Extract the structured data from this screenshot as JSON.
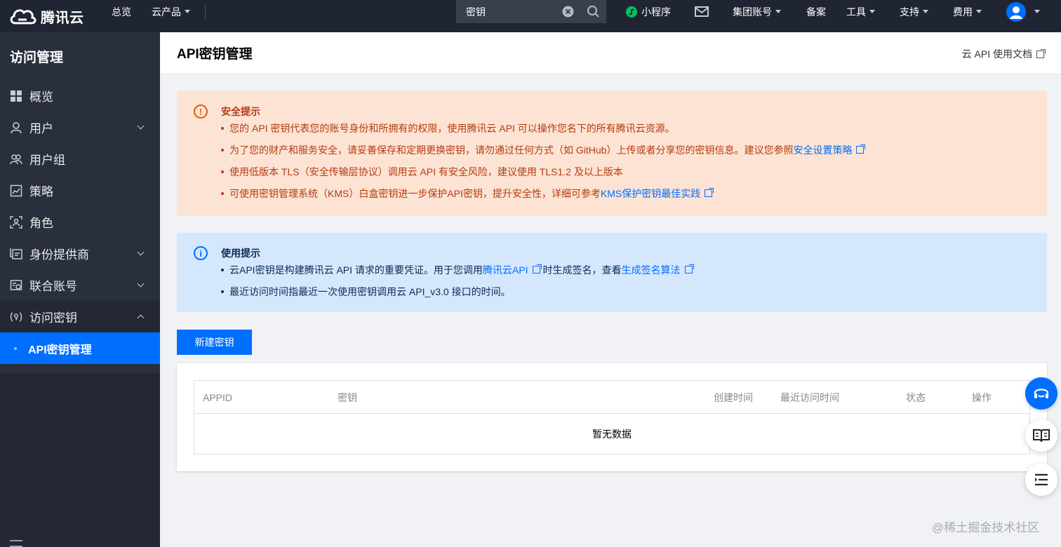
{
  "topbar": {
    "brand": "腾讯云",
    "nav": [
      "总览",
      "云产品"
    ],
    "search_value": "密钥",
    "mini_program": "小程序",
    "group_account": "集团账号",
    "filing": "备案",
    "tools": "工具",
    "support": "支持",
    "billing": "费用"
  },
  "sidebar": {
    "title": "访问管理",
    "items": [
      {
        "label": "概览",
        "icon": "grid-icon"
      },
      {
        "label": "用户",
        "icon": "user-icon"
      },
      {
        "label": "用户组",
        "icon": "users-icon"
      },
      {
        "label": "策略",
        "icon": "policy-icon"
      },
      {
        "label": "角色",
        "icon": "role-icon"
      },
      {
        "label": "身份提供商",
        "icon": "identity-provider-icon"
      },
      {
        "label": "联合账号",
        "icon": "federated-account-icon"
      },
      {
        "label": "访问密钥",
        "icon": "key-icon"
      }
    ],
    "sub_item": "API密钥管理"
  },
  "header": {
    "title": "API密钥管理",
    "doc_link": "云 API 使用文档"
  },
  "security_alert": {
    "title": "安全提示",
    "items": [
      {
        "text": "您的 API 密钥代表您的账号身份和所拥有的权限，使用腾讯云 API 可以操作您名下的所有腾讯云资源。"
      },
      {
        "text": "为了您的财产和服务安全，请妥善保存和定期更换密钥，请勿通过任何方式（如 GitHub）上传或者分享您的密钥信息。建议您参照",
        "link": "安全设置策略"
      },
      {
        "text": "使用低版本 TLS（安全传输层协议）调用云 API 有安全风险，建议使用 TLS1.2 及以上版本"
      },
      {
        "text": "可使用密钥管理系统（KMS）白盒密钥进一步保护API密钥，提升安全性，详细可参考",
        "link": "KMS保护密钥最佳实践"
      }
    ]
  },
  "usage_alert": {
    "title": "使用提示",
    "line1_a": "云API密钥是构建腾讯云 API 请求的重要凭证。用于您调用",
    "line1_link1": "腾讯云API",
    "line1_b": "时生成签名，查看",
    "line1_link2": "生成签名算法",
    "line2": "最近访问时间指最近一次使用密钥调用云 API_v3.0 接口的时间。"
  },
  "create_button": "新建密钥",
  "table": {
    "columns": [
      "APPID",
      "密钥",
      "创建时间",
      "最近访问时间",
      "状态",
      "操作"
    ],
    "empty_text": "暂无数据"
  },
  "watermark": "@稀土掘金技术社区",
  "colors": {
    "topbar_bg": "#1f2533",
    "sidebar_bg": "#292f3c",
    "accent": "#006eff",
    "warn_bg": "#fde3d3",
    "warn_text": "#b43c12",
    "info_bg": "#d5e7fd"
  }
}
